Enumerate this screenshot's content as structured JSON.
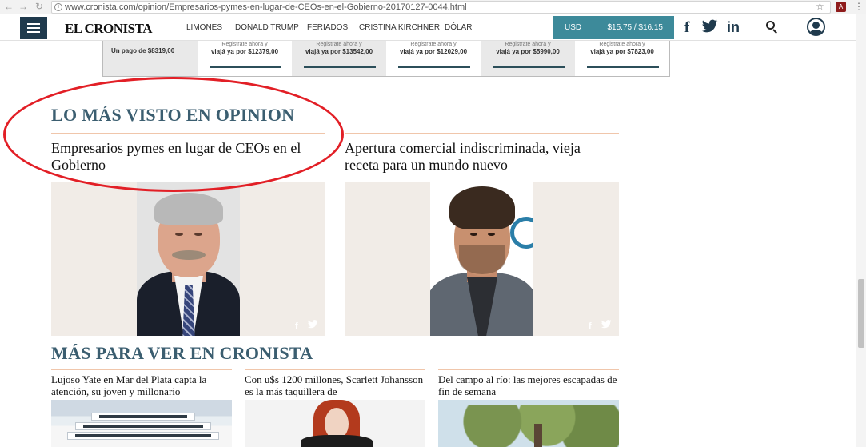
{
  "browser": {
    "url": "www.cronista.com/opinion/Empresarios-pymes-en-lugar-de-CEOs-en-el-Gobierno-20170127-0044.html"
  },
  "header": {
    "logo": "EL CRONISTA",
    "nav": [
      "LIMONES",
      "DONALD TRUMP",
      "FERIADOS",
      "CRISTINA KIRCHNER",
      "DÓLAR"
    ],
    "currency_label": "USD",
    "currency_value": "$15.75 / $16.15",
    "social_icons": [
      "facebook-icon",
      "twitter-icon",
      "linkedin-icon"
    ]
  },
  "ad": {
    "cells": [
      {
        "reg": "",
        "text": "Un pago de $8319,00"
      },
      {
        "reg": "Registrate ahora y",
        "text": "viajá ya por $12379,00"
      },
      {
        "reg": "Registrate ahora y",
        "text": "viajá ya por $13542,00"
      },
      {
        "reg": "Registrate ahora y",
        "text": "viajá ya por $12029,00"
      },
      {
        "reg": "Registrate ahora y",
        "text": "viajá ya por $5990,00"
      },
      {
        "reg": "Registrate ahora y",
        "text": "viajá ya por $7823,00"
      }
    ]
  },
  "most_viewed": {
    "title": "LO MÁS VISTO EN OPINION",
    "articles": [
      {
        "headline": "Empresarios pymes en lugar de CEOs en el Gobierno"
      },
      {
        "headline": "Apertura comercial indiscriminada, vieja receta para un mundo nuevo"
      }
    ]
  },
  "more": {
    "title": "MÁS PARA VER EN CRONISTA",
    "articles": [
      {
        "headline": "Lujoso Yate en Mar del Plata capta la atención, su joven y millonario"
      },
      {
        "headline": "Con u$s 1200 millones, Scarlett Johansson es la más taquillera de"
      },
      {
        "headline": "Del campo al río: las mejores escapadas de fin de semana"
      }
    ]
  },
  "colors": {
    "section_title": "#3b5e70",
    "currency_box": "#3d8a9a",
    "menu_button": "#1f3a4d",
    "annotation": "#e21f26",
    "divider": "#f0c6ab"
  }
}
